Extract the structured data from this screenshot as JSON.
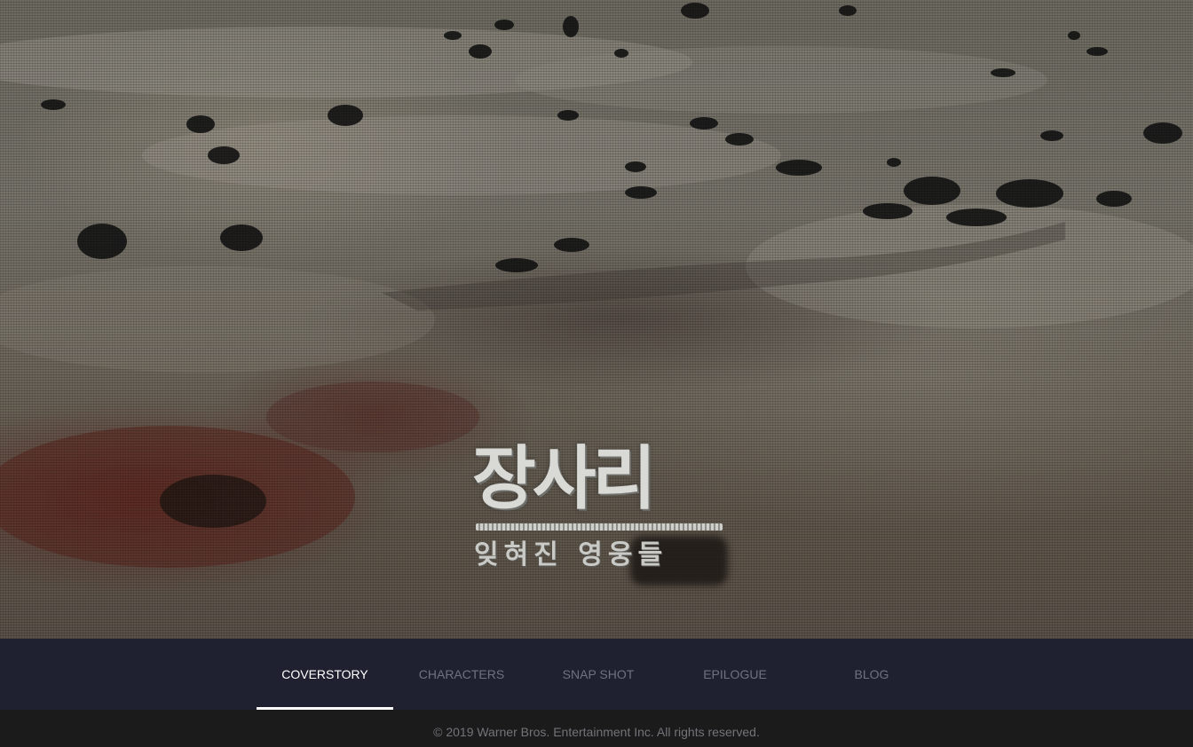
{
  "hero": {
    "logo_title": "장사리",
    "logo_subtitle": "잊혀진 영웅들"
  },
  "nav": {
    "items": [
      {
        "label": "COVERSTORY",
        "active": true
      },
      {
        "label": "CHARACTERS",
        "active": false
      },
      {
        "label": "SNAP SHOT",
        "active": false
      },
      {
        "label": "EPILOGUE",
        "active": false
      },
      {
        "label": "BLOG",
        "active": false
      }
    ]
  },
  "footer": {
    "copyright": "© 2019 Warner Bros. Entertainment Inc. All rights reserved."
  },
  "colors": {
    "nav_background": "#1f2130",
    "nav_active_text": "#ffffff",
    "nav_inactive_text": "#6f7182",
    "footer_background": "#1b1b1b",
    "footer_text": "#73737a"
  }
}
